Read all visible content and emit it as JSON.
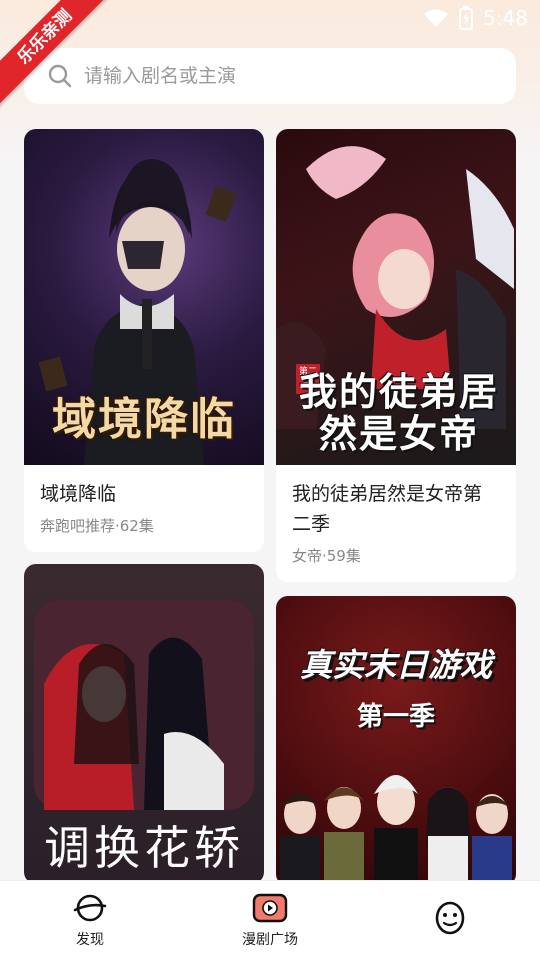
{
  "status_bar": {
    "time": "5:48"
  },
  "ribbon": {
    "text": "乐乐亲测"
  },
  "search": {
    "placeholder": "请输入剧名或主演"
  },
  "cards": [
    {
      "title": "域境降临",
      "cover_text": "域境降临",
      "subtitle": "奔跑吧推荐·62集"
    },
    {
      "title": "我的徒弟居然是女帝第二季",
      "cover_text": "我的徒弟居然是女帝",
      "cover_badge": "第二季",
      "subtitle": "女帝·59集"
    },
    {
      "title": "调换花轿",
      "cover_text": "调换花轿"
    },
    {
      "title": "真实末日游戏",
      "cover_text": "真实末日游戏",
      "cover_sub": "第一季"
    }
  ],
  "nav": [
    {
      "label": "发现",
      "icon": "planet-icon"
    },
    {
      "label": "漫剧广场",
      "icon": "play-tv-icon"
    },
    {
      "label": "",
      "icon": "smiley-face-icon"
    }
  ],
  "colors": {
    "accent": "#e0252b",
    "background": "#f5f5f5"
  }
}
